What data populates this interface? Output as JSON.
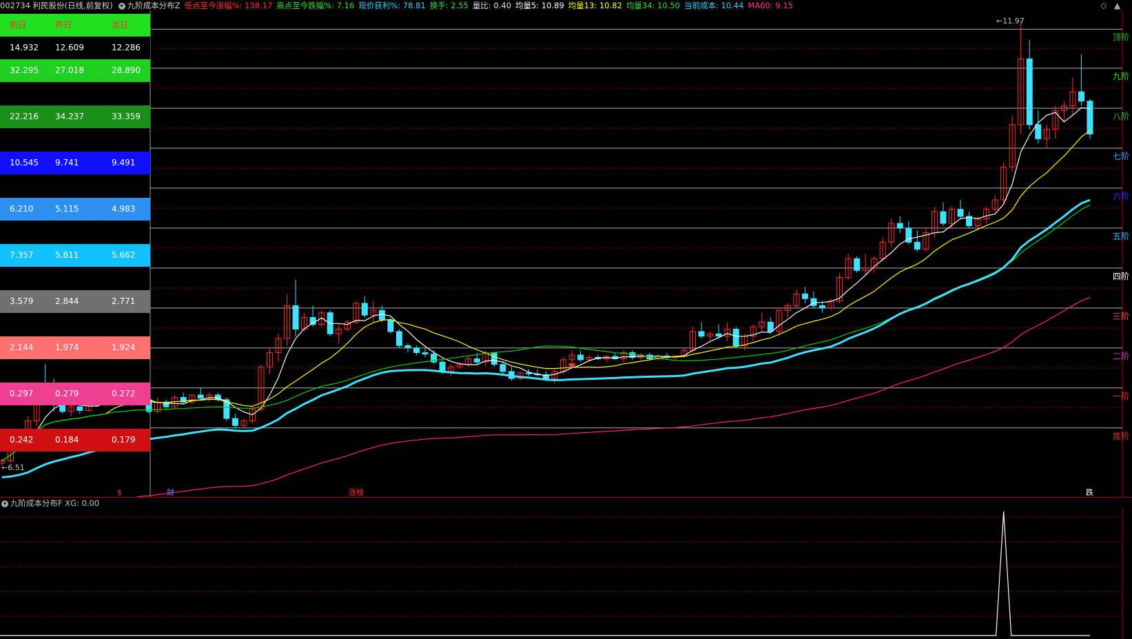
{
  "header": {
    "code_name": "002734 利民股份(日线,前复权)",
    "indicator_name": "九阶成本分布Z",
    "stats": [
      {
        "label": "低点至今涨幅%: 138.17",
        "color": "#ff3030"
      },
      {
        "label": "高点至今跌幅%: 7.16",
        "color": "#30e030"
      },
      {
        "label": "现价获利%: 78.81",
        "color": "#30d0ff"
      },
      {
        "label": "换手: 2.55",
        "color": "#30e030"
      },
      {
        "label": "量比: 0.40",
        "color": "#e0e0e0"
      },
      {
        "label": "均量5: 10.89",
        "color": "#ffffff"
      },
      {
        "label": "均量13: 10.82",
        "color": "#ffff30"
      },
      {
        "label": "均量34: 10.50",
        "color": "#30e030"
      },
      {
        "label": "当前成本: 10.44",
        "color": "#30d0ff"
      },
      {
        "label": "MA60: 9.15",
        "color": "#ff3090"
      }
    ],
    "controls": [
      "◇",
      "▲"
    ]
  },
  "level_table": {
    "headers": [
      "前日",
      "昨日",
      "当日"
    ],
    "rows": [
      {
        "values": [
          "14.932",
          "12.609",
          "12.286"
        ],
        "bg": "#000000",
        "fg": "#ffffff"
      },
      {
        "values": [
          "32.295",
          "27.018",
          "28.890"
        ],
        "bg": "#20d020",
        "fg": "#ffffff"
      },
      {
        "values": [
          "22.216",
          "34.237",
          "33.359"
        ],
        "bg": "#1a901a",
        "fg": "#ffffff"
      },
      {
        "values": [
          "10.545",
          "9.741",
          "9.491"
        ],
        "bg": "#1010ff",
        "fg": "#ffffff"
      },
      {
        "values": [
          "6.210",
          "5.115",
          "4.983"
        ],
        "bg": "#2d90f0",
        "fg": "#ffffff"
      },
      {
        "values": [
          "7.357",
          "5.811",
          "5.662"
        ],
        "bg": "#10c0ff",
        "fg": "#ffffff"
      },
      {
        "values": [
          "3.579",
          "2.844",
          "2.771"
        ],
        "bg": "#707070",
        "fg": "#ffffff"
      },
      {
        "values": [
          "2.144",
          "1.974",
          "1.924"
        ],
        "bg": "#ff7070",
        "fg": "#ffffff"
      },
      {
        "values": [
          "0.297",
          "0.279",
          "0.272"
        ],
        "bg": "#ee3f90",
        "fg": "#ffffff"
      },
      {
        "values": [
          "0.242",
          "0.184",
          "0.179"
        ],
        "bg": "#d01010",
        "fg": "#ffffff"
      }
    ]
  },
  "level_labels": [
    {
      "text": "顶阶",
      "color": "#20c020"
    },
    {
      "text": "九阶",
      "color": "#30e030"
    },
    {
      "text": "八阶",
      "color": "#30c030"
    },
    {
      "text": "七阶",
      "color": "#30a0ff"
    },
    {
      "text": "六阶",
      "color": "#3030ff"
    },
    {
      "text": "五阶",
      "color": "#30c0ff"
    },
    {
      "text": "四阶",
      "color": "#ffffff"
    },
    {
      "text": "三阶",
      "color": "#ff5050"
    },
    {
      "text": "二阶",
      "color": "#c040c0"
    },
    {
      "text": "一阶",
      "color": "#e03030"
    },
    {
      "text": "底阶",
      "color": "#e03030"
    }
  ],
  "price_annotations": {
    "high": "11.97",
    "low": "6.51"
  },
  "event_markers": [
    {
      "text": "$",
      "color": "#ff3030"
    },
    {
      "text": "财",
      "color": "#8080ff"
    },
    {
      "text": "涨榜",
      "color": "#ff3030"
    },
    {
      "text": "跌",
      "color": "#ffffff"
    }
  ],
  "sub_panel": {
    "title": "九阶成本分布F  XG: 0.00"
  },
  "chart_data": {
    "type": "candlestick",
    "ohlc": [
      [
        6.5,
        6.6,
        6.45,
        6.55
      ],
      [
        6.55,
        6.85,
        6.5,
        6.8
      ],
      [
        6.8,
        7.2,
        6.75,
        7.1
      ],
      [
        7.1,
        7.5,
        7.0,
        7.4
      ],
      [
        7.4,
        8.2,
        7.3,
        8.05
      ],
      [
        8.1,
        8.6,
        7.9,
        8.0
      ],
      [
        8.0,
        8.3,
        7.6,
        7.75
      ],
      [
        7.75,
        7.85,
        7.55,
        7.6
      ],
      [
        7.6,
        7.8,
        7.5,
        7.7
      ],
      [
        7.7,
        7.85,
        7.55,
        7.62
      ],
      [
        7.62,
        7.95,
        7.6,
        7.9
      ],
      [
        7.9,
        8.0,
        7.7,
        7.75
      ],
      [
        7.75,
        7.95,
        7.7,
        7.9
      ],
      [
        7.9,
        8.2,
        7.85,
        8.1
      ],
      [
        8.1,
        8.1,
        7.7,
        7.75
      ],
      [
        7.75,
        8.0,
        7.7,
        7.95
      ],
      [
        7.95,
        8.05,
        7.8,
        7.85
      ],
      [
        7.85,
        7.95,
        7.55,
        7.6
      ],
      [
        7.6,
        7.9,
        7.55,
        7.8
      ],
      [
        7.8,
        7.85,
        7.65,
        7.7
      ],
      [
        7.7,
        7.95,
        7.65,
        7.9
      ],
      [
        7.9,
        8.0,
        7.75,
        7.8
      ],
      [
        7.8,
        7.95,
        7.75,
        7.95
      ],
      [
        7.95,
        8.1,
        7.85,
        7.88
      ],
      [
        7.88,
        8.0,
        7.8,
        7.95
      ],
      [
        7.95,
        8.0,
        7.8,
        7.85
      ],
      [
        7.85,
        7.9,
        7.4,
        7.45
      ],
      [
        7.45,
        7.55,
        7.25,
        7.3
      ],
      [
        7.3,
        7.45,
        7.25,
        7.4
      ],
      [
        7.4,
        7.7,
        7.35,
        7.65
      ],
      [
        7.65,
        8.6,
        7.6,
        8.55
      ],
      [
        8.55,
        8.95,
        8.4,
        8.85
      ],
      [
        8.85,
        9.25,
        8.65,
        9.15
      ],
      [
        9.15,
        10.1,
        9.0,
        9.85
      ],
      [
        9.85,
        10.4,
        9.2,
        9.35
      ],
      [
        9.35,
        9.7,
        9.3,
        9.6
      ],
      [
        9.6,
        9.85,
        9.4,
        9.45
      ],
      [
        9.45,
        9.75,
        9.4,
        9.7
      ],
      [
        9.7,
        9.75,
        9.2,
        9.25
      ],
      [
        9.25,
        9.45,
        9.05,
        9.35
      ],
      [
        9.35,
        9.55,
        9.3,
        9.5
      ],
      [
        9.5,
        9.95,
        9.45,
        9.9
      ],
      [
        9.9,
        10.05,
        9.6,
        9.65
      ],
      [
        9.65,
        9.95,
        9.5,
        9.75
      ],
      [
        9.75,
        9.85,
        9.5,
        9.55
      ],
      [
        9.55,
        9.6,
        9.25,
        9.3
      ],
      [
        9.3,
        9.35,
        8.95,
        9.0
      ],
      [
        9.0,
        9.05,
        8.85,
        8.95
      ],
      [
        8.95,
        9.0,
        8.8,
        8.85
      ],
      [
        8.85,
        8.95,
        8.75,
        8.82
      ],
      [
        8.82,
        8.9,
        8.6,
        8.65
      ],
      [
        8.65,
        8.7,
        8.4,
        8.45
      ],
      [
        8.45,
        8.6,
        8.35,
        8.55
      ],
      [
        8.55,
        8.65,
        8.5,
        8.6
      ],
      [
        8.6,
        8.8,
        8.55,
        8.72
      ],
      [
        8.72,
        8.85,
        8.6,
        8.65
      ],
      [
        8.65,
        8.9,
        8.55,
        8.85
      ],
      [
        8.85,
        8.85,
        8.55,
        8.6
      ],
      [
        8.6,
        8.65,
        8.35,
        8.45
      ],
      [
        8.45,
        8.55,
        8.25,
        8.3
      ],
      [
        8.3,
        8.45,
        8.25,
        8.42
      ],
      [
        8.42,
        8.5,
        8.35,
        8.4
      ],
      [
        8.4,
        8.5,
        8.35,
        8.38
      ],
      [
        8.38,
        8.45,
        8.25,
        8.3
      ],
      [
        8.3,
        8.5,
        8.2,
        8.45
      ],
      [
        8.45,
        8.75,
        8.4,
        8.7
      ],
      [
        8.7,
        8.9,
        8.6,
        8.8
      ],
      [
        8.8,
        8.9,
        8.65,
        8.7
      ],
      [
        8.7,
        8.8,
        8.65,
        8.75
      ],
      [
        8.75,
        8.8,
        8.7,
        8.72
      ],
      [
        8.72,
        8.8,
        8.65,
        8.77
      ],
      [
        8.77,
        8.85,
        8.7,
        8.72
      ],
      [
        8.72,
        8.9,
        8.65,
        8.85
      ],
      [
        8.85,
        8.9,
        8.7,
        8.75
      ],
      [
        8.75,
        8.85,
        8.7,
        8.8
      ],
      [
        8.8,
        8.85,
        8.7,
        8.72
      ],
      [
        8.72,
        8.8,
        8.68,
        8.78
      ],
      [
        8.78,
        8.85,
        8.7,
        8.75
      ],
      [
        8.75,
        8.8,
        8.7,
        8.78
      ],
      [
        8.78,
        8.95,
        8.75,
        8.9
      ],
      [
        8.9,
        9.4,
        8.85,
        9.3
      ],
      [
        9.3,
        9.5,
        9.15,
        9.2
      ],
      [
        9.2,
        9.3,
        9.1,
        9.25
      ],
      [
        9.25,
        9.45,
        9.15,
        9.2
      ],
      [
        9.2,
        9.5,
        9.1,
        9.35
      ],
      [
        9.35,
        9.4,
        8.95,
        9.0
      ],
      [
        9.0,
        9.25,
        8.9,
        9.2
      ],
      [
        9.2,
        9.45,
        9.1,
        9.4
      ],
      [
        9.4,
        9.7,
        9.3,
        9.5
      ],
      [
        9.5,
        9.6,
        9.25,
        9.3
      ],
      [
        9.3,
        9.8,
        9.2,
        9.75
      ],
      [
        9.75,
        9.9,
        9.6,
        9.85
      ],
      [
        9.85,
        10.2,
        9.8,
        10.1
      ],
      [
        10.1,
        10.25,
        9.9,
        10.0
      ],
      [
        10.0,
        10.15,
        9.8,
        9.85
      ],
      [
        9.85,
        9.95,
        9.7,
        9.8
      ],
      [
        9.8,
        10.0,
        9.75,
        9.95
      ],
      [
        9.95,
        10.55,
        9.9,
        10.45
      ],
      [
        10.45,
        10.95,
        10.4,
        10.85
      ],
      [
        10.85,
        10.9,
        10.55,
        10.6
      ],
      [
        10.6,
        10.95,
        10.5,
        10.65
      ],
      [
        10.65,
        10.9,
        10.55,
        10.85
      ],
      [
        10.85,
        11.3,
        10.8,
        11.2
      ],
      [
        11.2,
        11.7,
        11.1,
        11.6
      ],
      [
        11.6,
        11.75,
        11.4,
        11.5
      ],
      [
        11.5,
        11.65,
        11.15,
        11.2
      ],
      [
        11.2,
        11.45,
        11.0,
        11.05
      ],
      [
        11.05,
        11.5,
        11.0,
        11.4
      ],
      [
        11.4,
        11.95,
        11.3,
        11.85
      ],
      [
        11.85,
        12.05,
        11.55,
        11.6
      ],
      [
        11.6,
        11.95,
        11.5,
        11.9
      ],
      [
        11.9,
        12.1,
        11.7,
        11.75
      ],
      [
        11.75,
        11.85,
        11.5,
        11.55
      ],
      [
        11.55,
        11.75,
        11.45,
        11.7
      ],
      [
        11.7,
        11.95,
        11.6,
        11.9
      ],
      [
        11.9,
        12.2,
        11.85,
        12.1
      ],
      [
        12.1,
        12.9,
        12.0,
        12.8
      ],
      [
        12.8,
        13.9,
        12.7,
        13.7
      ],
      [
        13.7,
        15.9,
        13.5,
        15.1
      ],
      [
        15.1,
        15.5,
        13.6,
        13.7
      ],
      [
        13.7,
        14.0,
        13.3,
        13.4
      ],
      [
        13.4,
        13.7,
        13.2,
        13.6
      ],
      [
        13.6,
        14.1,
        13.4,
        14.0
      ],
      [
        14.0,
        14.2,
        13.75,
        14.1
      ],
      [
        14.1,
        14.7,
        13.9,
        14.4
      ],
      [
        14.4,
        15.2,
        14.1,
        14.2
      ],
      [
        14.2,
        14.25,
        13.4,
        13.5
      ]
    ],
    "ma_series": [
      {
        "name": "5",
        "color": "#ffffff"
      },
      {
        "name": "13",
        "color": "#ffff00"
      },
      {
        "name": "34",
        "color": "#00d000"
      },
      {
        "name": "当前成本",
        "color": "#40e0ff"
      },
      {
        "name": "MA60",
        "color": "#ff2080"
      }
    ],
    "level_lines": [
      15.73,
      14.9,
      14.05,
      13.2,
      12.35,
      11.5,
      10.65,
      9.8,
      8.95,
      8.1,
      7.25
    ],
    "ylim": [
      6.0,
      16.0
    ],
    "sub_series": {
      "name": "XG",
      "values_nonzero_index": 116,
      "ylim": [
        0,
        1
      ]
    }
  }
}
